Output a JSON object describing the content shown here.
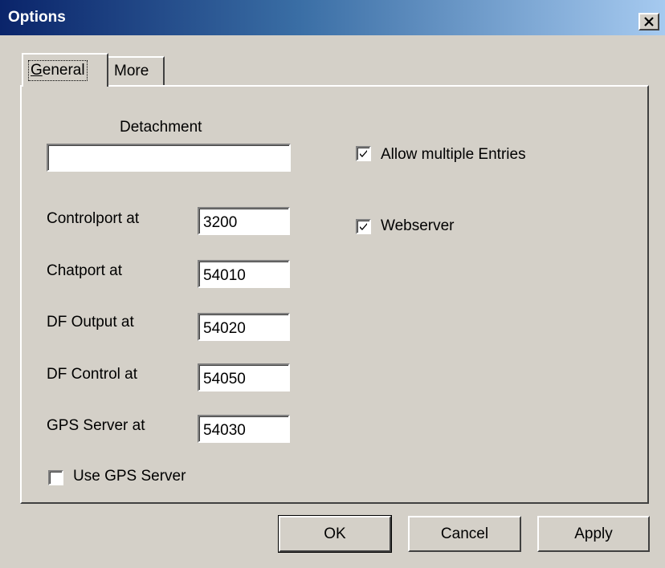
{
  "window": {
    "title": "Options",
    "titlebar_color_start": "#0a246a",
    "titlebar_color_end": "#a6caf0"
  },
  "tabs": [
    {
      "label": "General",
      "mnemonic": "G",
      "rest": "eneral",
      "selected": true
    },
    {
      "label": "More",
      "selected": false
    }
  ],
  "general": {
    "detachment_label": "Detachment",
    "detachment_value": "",
    "allow_multiple_label": "Allow multiple Entries",
    "allow_multiple_checked": true,
    "webserver_label": "Webserver",
    "webserver_checked": true,
    "controlport_label": "Controlport at",
    "controlport_value": "3200",
    "chatport_label": "Chatport at",
    "chatport_value": "54010",
    "df_output_label": "DF Output at",
    "df_output_value": "54020",
    "df_control_label": "DF Control at",
    "df_control_value": "54050",
    "gps_server_label": "GPS Server at",
    "gps_server_value": "54030",
    "use_gps_label": "Use GPS Server",
    "use_gps_checked": false
  },
  "buttons": {
    "ok": "OK",
    "cancel": "Cancel",
    "apply": "Apply"
  }
}
